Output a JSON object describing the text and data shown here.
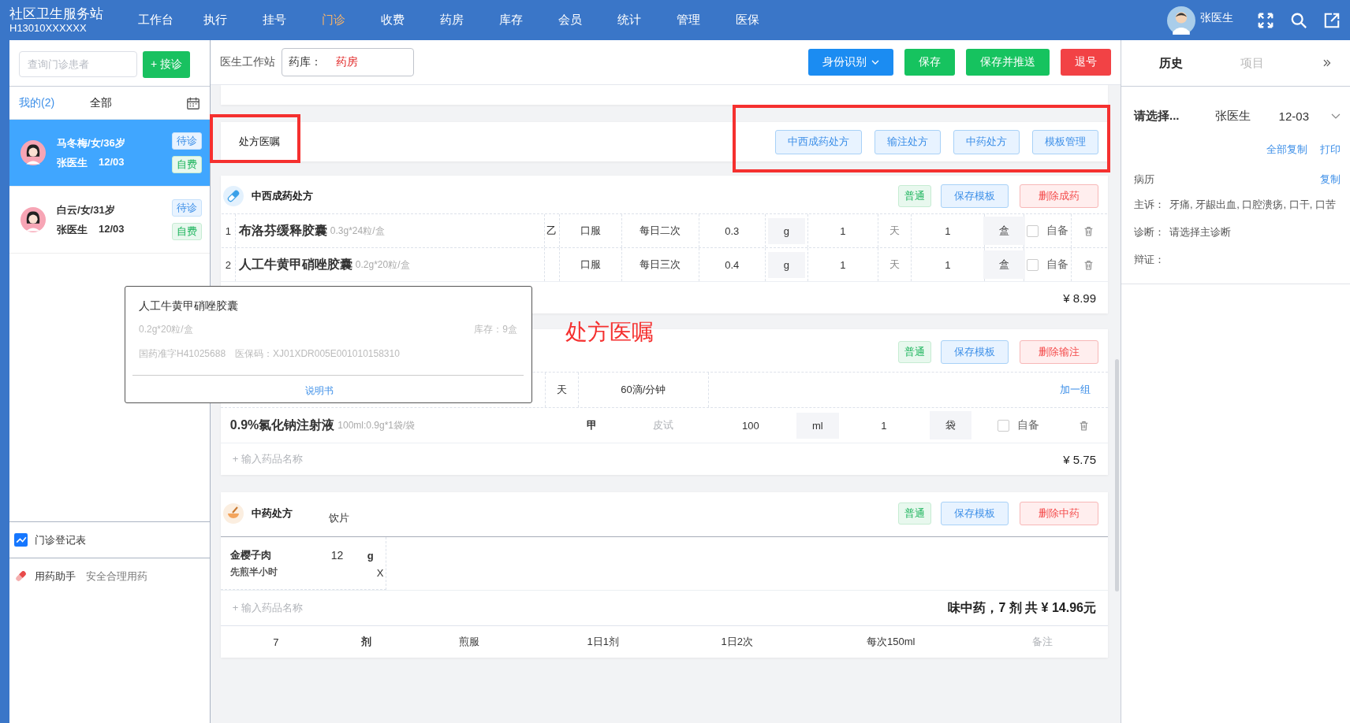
{
  "app": {
    "name": "社区卫生服务站",
    "code": "H13010XXXXXX"
  },
  "nav": [
    {
      "label": "工作台",
      "selected": false
    },
    {
      "label": "执行",
      "selected": false
    },
    {
      "label": "挂号",
      "selected": false
    },
    {
      "label": "门诊",
      "selected": true
    },
    {
      "label": "收费",
      "selected": false
    },
    {
      "label": "药房",
      "selected": false
    },
    {
      "label": "库存",
      "selected": false
    },
    {
      "label": "会员",
      "selected": false
    },
    {
      "label": "统计",
      "selected": false
    },
    {
      "label": "管理",
      "selected": false
    },
    {
      "label": "医保",
      "selected": false
    }
  ],
  "user": {
    "name": "张医生"
  },
  "patients_panel": {
    "search_placeholder": "查询门诊患者",
    "add_button": "+ 接诊",
    "tabs": [
      {
        "label": "我的(2)",
        "selected": true
      },
      {
        "label": "全部",
        "selected": false
      }
    ],
    "patients": [
      {
        "name": "马冬梅/女/36岁",
        "doctor": "张医生",
        "date": "12/03",
        "status": "待诊",
        "payment": "自费",
        "selected": true
      },
      {
        "name": "白云/女/31岁",
        "doctor": "张医生",
        "date": "12/03",
        "status": "待诊",
        "payment": "自费",
        "selected": false
      }
    ],
    "tools": [
      {
        "kind": "chart",
        "label": "门诊登记表"
      },
      {
        "kind": "pill",
        "label": "用药助手",
        "note": "安全合理用药"
      }
    ]
  },
  "toolbar": {
    "title": "医生工作站",
    "pharmacy_label": "药库：",
    "pharmacy_value": "药房",
    "buttons": [
      {
        "label": "身份识别",
        "kind": "dropdown"
      },
      {
        "label": "保存",
        "kind": "success"
      },
      {
        "label": "保存并推送",
        "kind": "success"
      },
      {
        "label": "退号",
        "kind": "danger"
      }
    ]
  },
  "orders": {
    "title": "处方医嘱",
    "buttons": [
      "中西成药处方",
      "输注处方",
      "中药处方",
      "模板管理"
    ]
  },
  "western": {
    "title": "中西成药处方",
    "tag": "普通",
    "save_template": "保存模板",
    "delete": "删除成药",
    "rows": [
      {
        "index": "1",
        "name": "布洛芬缓释胶囊",
        "spec": "0.3g*24粒/盒",
        "grade": "乙",
        "route": "口服",
        "frequency": "每日二次",
        "dose": "0.3",
        "dose_unit": "g",
        "days": "1",
        "days_unit": "天",
        "quantity": "1",
        "pack_unit": "盒",
        "self_label": "自备",
        "self_supplied": false
      },
      {
        "index": "2",
        "name": "人工牛黄甲硝唑胶囊",
        "spec": "0.2g*20粒/盒",
        "route": "口服",
        "frequency": "每日三次",
        "dose": "0.4",
        "dose_unit": "g",
        "days": "1",
        "days_unit": "天",
        "quantity": "1",
        "pack_unit": "盒",
        "self_label": "自备",
        "self_supplied": false
      }
    ],
    "total": "¥ 8.99"
  },
  "tooltip": {
    "name": "人工牛黄甲硝唑胶囊",
    "spec": "0.2g*20粒/盒",
    "stock": "库存：9盒",
    "approval": "国药准字H41025688",
    "insurance_code": "医保码：XJ01XDR005E001010158310",
    "manual_link": "说明书"
  },
  "infusion": {
    "tag": "普通",
    "save_template": "保存模板",
    "delete": "删除输注",
    "group": {
      "days_unit": "天",
      "drip_rate": "60滴/分钟",
      "add_group": "加一组"
    },
    "rows": [
      {
        "name": "0.9%氯化钠注射液",
        "spec": "100ml:0.9g*1袋/袋",
        "grade": "甲",
        "skin_test": "皮试",
        "dose": "100",
        "dose_unit": "ml",
        "quantity": "1",
        "pack_unit": "袋",
        "self_label": "自备",
        "self_supplied": false
      }
    ],
    "input_placeholder": "+ 输入药品名称",
    "total": "¥ 5.75"
  },
  "herbal": {
    "title": "中药处方",
    "form": "饮片",
    "tag": "普通",
    "save_template": "保存模板",
    "delete": "删除中药",
    "items": [
      {
        "name": "金樱子肉",
        "amount": "12",
        "unit": "g",
        "note": "先煎半小时",
        "remove": "X"
      }
    ],
    "input_placeholder": "+ 输入药品名称",
    "total": "味中药，7 剂 共 ¥ 14.96元",
    "footer": {
      "doses": "7",
      "dose_unit": "剂",
      "usage": "煎服",
      "daily": "1日1剂",
      "times": "1日2次",
      "amount": "每次150ml",
      "remark_placeholder": "备注"
    }
  },
  "history_panel": {
    "tabs": [
      {
        "label": "历史",
        "selected": true
      },
      {
        "label": "项目",
        "selected": false
      }
    ],
    "select": "请选择...",
    "doctor": "张医生",
    "date": "12-03",
    "copy_all": "全部复制",
    "print": "打印",
    "record_title": "病历",
    "copy": "复制",
    "fields": [
      {
        "label": "主诉：",
        "value": "牙痛, 牙龈出血, 口腔溃疡, 口干, 口苦"
      },
      {
        "label": "诊断：",
        "value": "请选择主诊断"
      },
      {
        "label": "辩证："
      }
    ]
  },
  "annotation": {
    "label": "处方医嘱"
  }
}
